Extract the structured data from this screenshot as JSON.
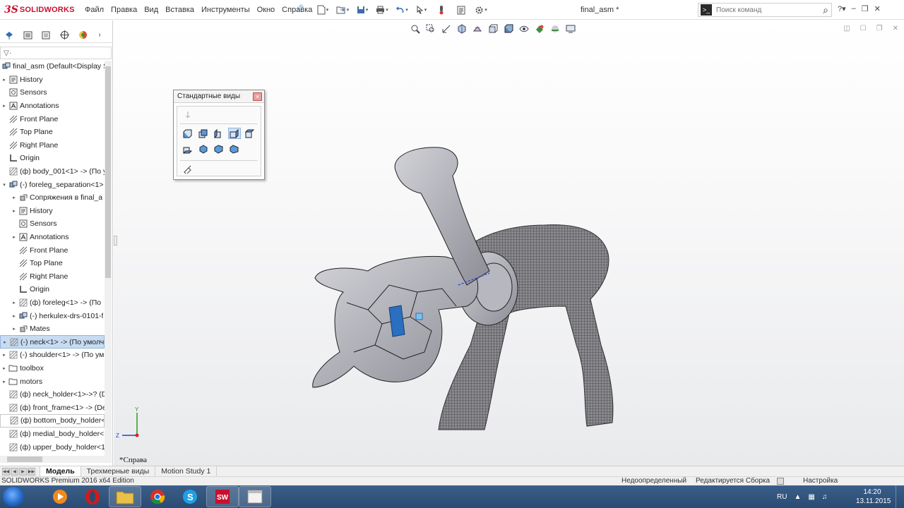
{
  "app": {
    "logo_prefix": "3S",
    "logo_name": "SOLIDWORKS",
    "document_title": "final_asm *",
    "accent_color": "#c8102e",
    "selection_color": "#c7dcf2"
  },
  "menu": [
    "Файл",
    "Правка",
    "Вид",
    "Вставка",
    "Инструменты",
    "Окно",
    "Справка"
  ],
  "command_search": {
    "placeholder": "Поиск команд"
  },
  "feature_tree": {
    "root": "final_asm  (Default<Display S",
    "items": [
      {
        "label": "History",
        "level": 1,
        "expand": true,
        "icon": "history-icon"
      },
      {
        "label": "Sensors",
        "level": 1,
        "expand": false,
        "icon": "sensor-icon"
      },
      {
        "label": "Annotations",
        "level": 1,
        "expand": true,
        "icon": "annotation-icon"
      },
      {
        "label": "Front Plane",
        "level": 1,
        "expand": false,
        "icon": "plane-icon"
      },
      {
        "label": "Top Plane",
        "level": 1,
        "expand": false,
        "icon": "plane-icon"
      },
      {
        "label": "Right Plane",
        "level": 1,
        "expand": false,
        "icon": "plane-icon"
      },
      {
        "label": "Origin",
        "level": 1,
        "expand": false,
        "icon": "origin-icon"
      },
      {
        "label": "(ф) body_001<1> -> (По у",
        "level": 1,
        "expand": false,
        "icon": "part-icon"
      },
      {
        "label": "(-) foreleg_separation<1>",
        "level": 1,
        "expand": true,
        "expanded": true,
        "icon": "assembly-icon"
      },
      {
        "label": "Сопряжения в final_a",
        "level": 2,
        "expand": true,
        "icon": "mates-icon"
      },
      {
        "label": "History",
        "level": 2,
        "expand": true,
        "icon": "history-icon"
      },
      {
        "label": "Sensors",
        "level": 2,
        "expand": false,
        "icon": "sensor-icon"
      },
      {
        "label": "Annotations",
        "level": 2,
        "expand": true,
        "icon": "annotation-icon"
      },
      {
        "label": "Front Plane",
        "level": 2,
        "expand": false,
        "icon": "plane-icon"
      },
      {
        "label": "Top Plane",
        "level": 2,
        "expand": false,
        "icon": "plane-icon"
      },
      {
        "label": "Right Plane",
        "level": 2,
        "expand": false,
        "icon": "plane-icon"
      },
      {
        "label": "Origin",
        "level": 2,
        "expand": false,
        "icon": "origin-icon"
      },
      {
        "label": "(ф) foreleg<1> -> (По",
        "level": 2,
        "expand": true,
        "icon": "part-icon"
      },
      {
        "label": "(-) herkulex-drs-0101-f",
        "level": 2,
        "expand": true,
        "icon": "assembly-icon"
      },
      {
        "label": "Mates",
        "level": 2,
        "expand": true,
        "icon": "mates-icon"
      },
      {
        "label": "(-) neck<1> -> (По умолч",
        "level": 1,
        "expand": true,
        "selected": true,
        "icon": "part-icon"
      },
      {
        "label": "(-) shoulder<1> -> (По ум",
        "level": 1,
        "expand": true,
        "icon": "part-icon"
      },
      {
        "label": "toolbox",
        "level": 1,
        "expand": true,
        "icon": "folder-icon"
      },
      {
        "label": "motors",
        "level": 1,
        "expand": true,
        "icon": "folder-icon"
      },
      {
        "label": "(ф) neck_holder<1>->? (D",
        "level": 1,
        "expand": false,
        "icon": "part-icon"
      },
      {
        "label": "(ф) front_frame<1> -> (De",
        "level": 1,
        "expand": false,
        "icon": "part-icon"
      },
      {
        "label": "(ф) bottom_body_holder<",
        "level": 1,
        "expand": false,
        "boxed": true,
        "icon": "part-icon"
      },
      {
        "label": "(ф) medial_body_holder<",
        "level": 1,
        "expand": false,
        "icon": "part-icon"
      },
      {
        "label": "(ф) upper_body_holder<1",
        "level": 1,
        "expand": false,
        "icon": "part-icon"
      }
    ]
  },
  "standard_views_dialog": {
    "title": "Стандартные виды"
  },
  "viewport": {
    "view_name": "*Справа",
    "triad_y": "Y",
    "triad_z": "Z"
  },
  "bottom_tabs": [
    "Модель",
    "Трехмерные виды",
    "Motion Study 1"
  ],
  "status_bar": {
    "edition": "SOLIDWORKS Premium 2016 x64 Edition",
    "definition": "Недоопределенный",
    "editing": "Редактируется Сборка",
    "settings": "Настройка"
  },
  "taskbar": {
    "language": "RU",
    "time": "14:20",
    "date": "13.11.2015",
    "apps": [
      "media-player-icon",
      "folder-icon",
      "opera-icon",
      "chrome-icon",
      "skype-icon",
      "solidworks-icon",
      "window-icon"
    ]
  }
}
